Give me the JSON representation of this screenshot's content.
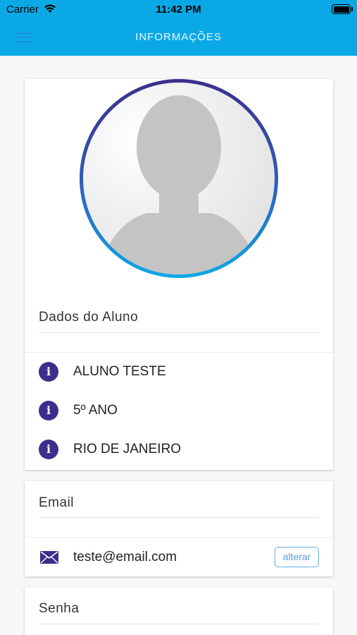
{
  "status_bar": {
    "carrier": "Carrier",
    "time": "11:42 PM"
  },
  "header": {
    "title": "INFORMAÇÕES"
  },
  "student_card": {
    "section_title": "Dados do Aluno",
    "items": [
      {
        "icon": "info-icon",
        "text": "ALUNO TESTE"
      },
      {
        "icon": "info-icon",
        "text": "5º ANO"
      },
      {
        "icon": "info-icon",
        "text": "RIO DE JANEIRO"
      }
    ]
  },
  "email_card": {
    "section_title": "Email",
    "icon": "mail-icon",
    "value": "teste@email.com",
    "change_label": "alterar"
  },
  "password_card": {
    "section_title": "Senha"
  },
  "colors": {
    "header_bg": "#0aa9e6",
    "accent_dark": "#3c2e8a",
    "button_border": "#68a9e8"
  }
}
